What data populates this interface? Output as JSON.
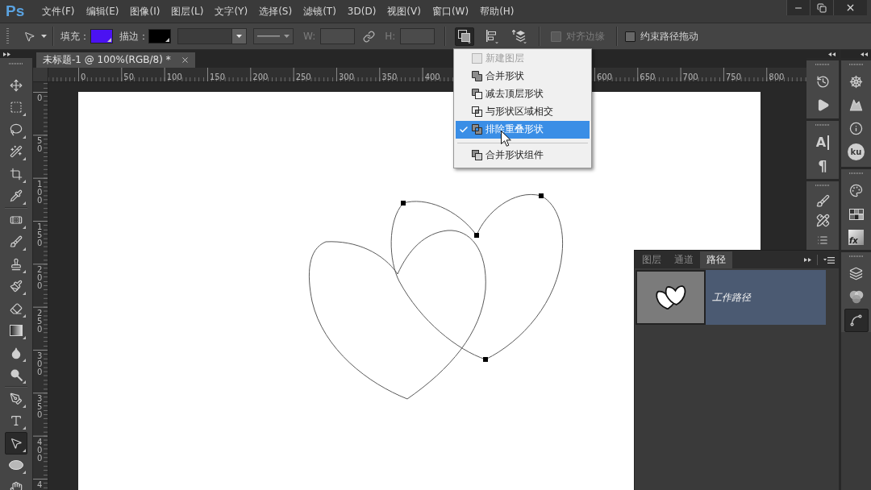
{
  "app": {
    "logo": "Ps"
  },
  "menu_bar": [
    {
      "label": "文件(F)"
    },
    {
      "label": "编辑(E)"
    },
    {
      "label": "图像(I)"
    },
    {
      "label": "图层(L)"
    },
    {
      "label": "文字(Y)"
    },
    {
      "label": "选择(S)"
    },
    {
      "label": "滤镜(T)"
    },
    {
      "label": "3D(D)"
    },
    {
      "label": "视图(V)"
    },
    {
      "label": "窗口(W)"
    },
    {
      "label": "帮助(H)"
    }
  ],
  "window_controls": [
    {
      "kind": "minimize"
    },
    {
      "kind": "restore"
    },
    {
      "kind": "close"
    }
  ],
  "options_bar": {
    "fill": {
      "label": "填充：",
      "color": "#4b12f2"
    },
    "stroke": {
      "label": "描边：",
      "color": "#000000"
    },
    "width_label": "W:",
    "height_label": "H:",
    "path_operations": {
      "expanded": true,
      "menu": {
        "groups": [
          {
            "items": [
              {
                "kind": "new_layer",
                "label": "新建图层",
                "disabled": true,
                "checked": false,
                "selected": false
              },
              {
                "kind": "combine",
                "label": "合并形状",
                "disabled": false,
                "checked": false,
                "selected": false
              },
              {
                "kind": "subtract",
                "label": "减去顶层形状",
                "disabled": false,
                "checked": false,
                "selected": false
              },
              {
                "kind": "intersect",
                "label": "与形状区域相交",
                "disabled": false,
                "checked": false,
                "selected": false
              },
              {
                "kind": "exclude",
                "label": "排除重叠形状",
                "disabled": false,
                "checked": true,
                "selected": true
              }
            ]
          },
          {
            "items": [
              {
                "kind": "merge_components",
                "label": "合并形状组件",
                "disabled": false,
                "checked": false,
                "selected": false
              }
            ]
          }
        ]
      }
    },
    "checkboxes": [
      {
        "label": "对齐边缘",
        "checked": false,
        "disabled": true
      },
      {
        "label": "约束路径拖动",
        "checked": false,
        "disabled": false
      }
    ]
  },
  "toolbar": {
    "groups": [
      {
        "tools": [
          {
            "kind": "move",
            "selected": false,
            "flyout": false
          },
          {
            "kind": "marquee",
            "selected": false,
            "flyout": true
          },
          {
            "kind": "lasso",
            "selected": false,
            "flyout": true
          },
          {
            "kind": "magic_wand",
            "selected": false,
            "flyout": true
          },
          {
            "kind": "crop",
            "selected": false,
            "flyout": true
          },
          {
            "kind": "eyedropper",
            "selected": false,
            "flyout": true
          }
        ]
      },
      {
        "tools": [
          {
            "kind": "healing",
            "selected": false,
            "flyout": true
          },
          {
            "kind": "brush",
            "selected": false,
            "flyout": true
          },
          {
            "kind": "stamp",
            "selected": false,
            "flyout": true
          },
          {
            "kind": "history_brush",
            "selected": false,
            "flyout": true
          },
          {
            "kind": "eraser",
            "selected": false,
            "flyout": true
          },
          {
            "kind": "gradient",
            "selected": false,
            "flyout": true
          },
          {
            "kind": "blur",
            "selected": false,
            "flyout": true
          },
          {
            "kind": "dodge",
            "selected": false,
            "flyout": true
          }
        ]
      },
      {
        "tools": [
          {
            "kind": "pen",
            "selected": false,
            "flyout": true
          },
          {
            "kind": "type",
            "selected": false,
            "flyout": true
          },
          {
            "kind": "path_selection",
            "selected": true,
            "flyout": true
          },
          {
            "kind": "ellipse",
            "selected": false,
            "flyout": true
          },
          {
            "kind": "hand",
            "selected": false
          }
        ]
      }
    ]
  },
  "document_tabs": [
    {
      "title": "未标题-1 @ 100%(RGB/8) *",
      "selected": true
    }
  ],
  "horizontal_ruler": {
    "left_labels": [
      "0",
      "50",
      "100",
      "150",
      "200",
      "250",
      "300",
      "350",
      "400"
    ],
    "right_labels": [
      "600",
      "650",
      "700",
      "750",
      "800"
    ]
  },
  "vertical_ruler": [
    "0",
    "50",
    "100",
    "150",
    "200",
    "250",
    "300",
    "350",
    "400",
    "4"
  ],
  "docks": [
    {
      "groups": [
        {
          "buttons": [
            {
              "kind": "history",
              "selected": false
            },
            {
              "kind": "actions",
              "selected": false
            }
          ]
        },
        {
          "buttons": [
            {
              "kind": "character",
              "glyph": "A",
              "selected": false
            },
            {
              "kind": "paragraph",
              "glyph": "¶",
              "selected": false
            }
          ]
        },
        {
          "buttons": [
            {
              "kind": "brush_presets",
              "selected": false
            },
            {
              "kind": "tool_presets",
              "selected": false
            },
            {
              "kind": "layer_comps",
              "selected": false
            }
          ]
        }
      ]
    },
    {
      "groups": [
        {
          "buttons": [
            {
              "kind": "navigator",
              "selected": false
            },
            {
              "kind": "histogram",
              "selected": false
            },
            {
              "kind": "info",
              "selected": false
            },
            {
              "kind": "kuler",
              "glyph": "ku",
              "selected": false
            }
          ]
        },
        {
          "buttons": [
            {
              "kind": "color",
              "selected": false
            },
            {
              "kind": "swatches",
              "selected": false
            },
            {
              "kind": "styles",
              "glyph": "fx",
              "selected": false
            }
          ]
        },
        {
          "buttons": [
            {
              "kind": "layers",
              "selected": false
            },
            {
              "kind": "channels",
              "selected": false
            },
            {
              "kind": "paths",
              "selected": true
            }
          ]
        }
      ]
    }
  ],
  "paths_panel": {
    "tabs": [
      {
        "label": "图层",
        "selected": false
      },
      {
        "label": "通道",
        "selected": false
      },
      {
        "label": "路径",
        "selected": true
      }
    ],
    "paths": [
      {
        "name": "工作路径",
        "selected": true
      }
    ]
  }
}
